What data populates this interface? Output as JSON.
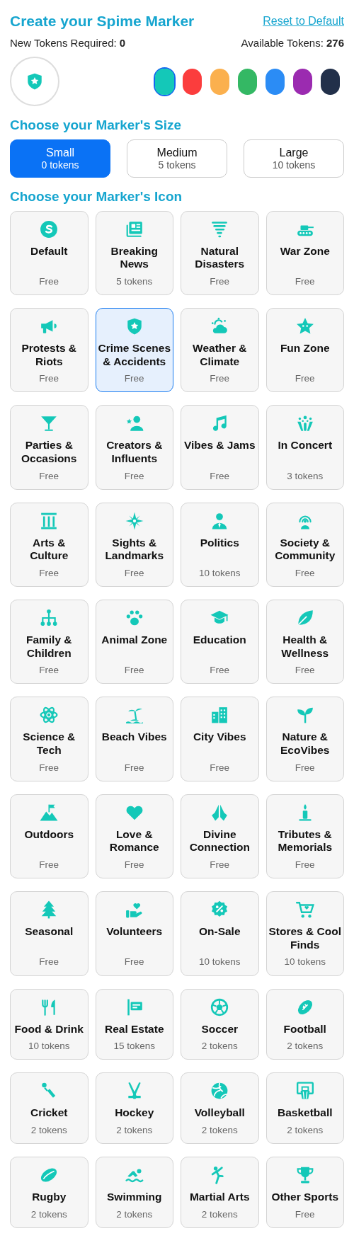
{
  "header": {
    "title": "Create your Spime Marker",
    "reset_link": "Reset to Default",
    "required_label": "New Tokens Required:",
    "required": "0",
    "available_label": "Available Tokens:",
    "available": "276"
  },
  "colors": [
    {
      "color": "#14c8b8",
      "selected": true
    },
    {
      "color": "#fb3d3d",
      "selected": false
    },
    {
      "color": "#fbb04e",
      "selected": false
    },
    {
      "color": "#34b864",
      "selected": false
    },
    {
      "color": "#2b8cf5",
      "selected": false
    },
    {
      "color": "#9b2bb0",
      "selected": false
    },
    {
      "color": "#22304a",
      "selected": false
    }
  ],
  "size_heading": "Choose your Marker's Size",
  "sizes": [
    {
      "label": "Small",
      "cost": "0 tokens",
      "selected": true
    },
    {
      "label": "Medium",
      "cost": "5 tokens",
      "selected": false
    },
    {
      "label": "Large",
      "cost": "10 tokens",
      "selected": false
    }
  ],
  "icon_heading": "Choose your Marker's Icon",
  "icons": [
    {
      "label": "Default",
      "cost": "Free",
      "selected": false
    },
    {
      "label": "Breaking News",
      "cost": "5 tokens",
      "selected": false
    },
    {
      "label": "Natural Disasters",
      "cost": "Free",
      "selected": false
    },
    {
      "label": "War Zone",
      "cost": "Free",
      "selected": false
    },
    {
      "label": "Protests & Riots",
      "cost": "Free",
      "selected": false
    },
    {
      "label": "Crime Scenes & Accidents",
      "cost": "Free",
      "selected": true
    },
    {
      "label": "Weather & Climate",
      "cost": "Free",
      "selected": false
    },
    {
      "label": "Fun Zone",
      "cost": "Free",
      "selected": false
    },
    {
      "label": "Parties & Occasions",
      "cost": "Free",
      "selected": false
    },
    {
      "label": "Creators & Influents",
      "cost": "Free",
      "selected": false
    },
    {
      "label": "Vibes & Jams",
      "cost": "Free",
      "selected": false
    },
    {
      "label": "In Concert",
      "cost": "3 tokens",
      "selected": false
    },
    {
      "label": "Arts & Culture",
      "cost": "Free",
      "selected": false
    },
    {
      "label": "Sights & Landmarks",
      "cost": "Free",
      "selected": false
    },
    {
      "label": "Politics",
      "cost": "10 tokens",
      "selected": false
    },
    {
      "label": "Society & Community",
      "cost": "Free",
      "selected": false
    },
    {
      "label": "Family & Children",
      "cost": "Free",
      "selected": false
    },
    {
      "label": "Animal Zone",
      "cost": "Free",
      "selected": false
    },
    {
      "label": "Education",
      "cost": "Free",
      "selected": false
    },
    {
      "label": "Health & Wellness",
      "cost": "Free",
      "selected": false
    },
    {
      "label": "Science & Tech",
      "cost": "Free",
      "selected": false
    },
    {
      "label": "Beach Vibes",
      "cost": "Free",
      "selected": false
    },
    {
      "label": "City Vibes",
      "cost": "Free",
      "selected": false
    },
    {
      "label": "Nature & EcoVibes",
      "cost": "Free",
      "selected": false
    },
    {
      "label": "Outdoors",
      "cost": "Free",
      "selected": false
    },
    {
      "label": "Love & Romance",
      "cost": "Free",
      "selected": false
    },
    {
      "label": "Divine Connection",
      "cost": "Free",
      "selected": false
    },
    {
      "label": "Tributes & Memorials",
      "cost": "Free",
      "selected": false
    },
    {
      "label": "Seasonal",
      "cost": "Free",
      "selected": false
    },
    {
      "label": "Volunteers",
      "cost": "Free",
      "selected": false
    },
    {
      "label": "On-Sale",
      "cost": "10 tokens",
      "selected": false
    },
    {
      "label": "Stores & Cool Finds",
      "cost": "10 tokens",
      "selected": false
    },
    {
      "label": "Food & Drink",
      "cost": "10 tokens",
      "selected": false
    },
    {
      "label": "Real Estate",
      "cost": "15 tokens",
      "selected": false
    },
    {
      "label": "Soccer",
      "cost": "2 tokens",
      "selected": false
    },
    {
      "label": "Football",
      "cost": "2 tokens",
      "selected": false
    },
    {
      "label": "Cricket",
      "cost": "2 tokens",
      "selected": false
    },
    {
      "label": "Hockey",
      "cost": "2 tokens",
      "selected": false
    },
    {
      "label": "Volleyball",
      "cost": "2 tokens",
      "selected": false
    },
    {
      "label": "Basketball",
      "cost": "2 tokens",
      "selected": false
    },
    {
      "label": "Rugby",
      "cost": "2 tokens",
      "selected": false
    },
    {
      "label": "Swimming",
      "cost": "2 tokens",
      "selected": false
    },
    {
      "label": "Martial Arts",
      "cost": "2 tokens",
      "selected": false
    },
    {
      "label": "Other Sports",
      "cost": "Free",
      "selected": false
    }
  ]
}
